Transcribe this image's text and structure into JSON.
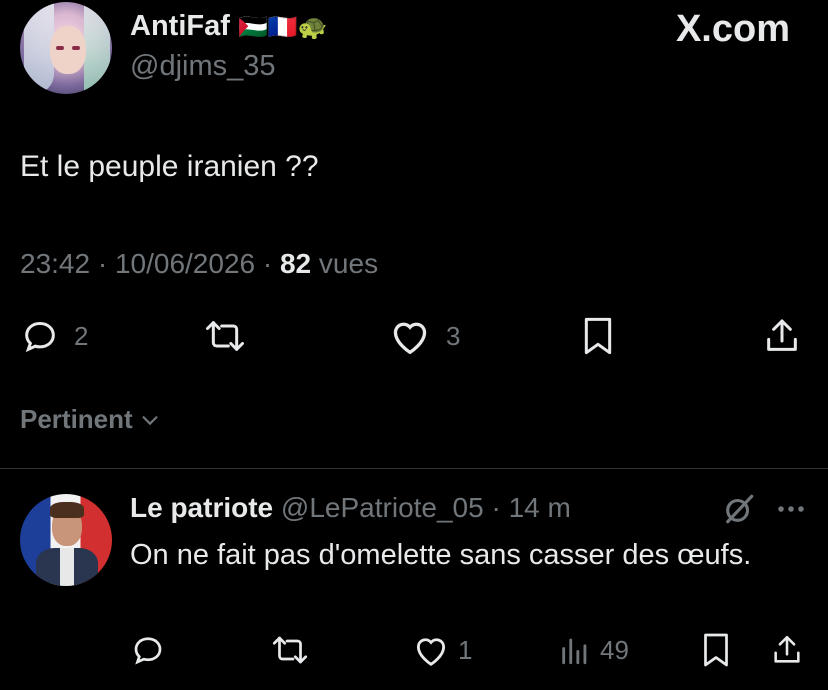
{
  "tweet": {
    "display_name": "AntiFaf",
    "flags": "🇵🇸🇫🇷🐢",
    "handle": "@djims_35",
    "brand": "X.com",
    "text": "Et le peuple iranien ??",
    "time": "23:42 · 10/06/2026 · ",
    "views_count": "82",
    "views_label": " vues",
    "actions": {
      "reply_count": "2",
      "like_count": "3"
    }
  },
  "sort": {
    "label": "Pertinent"
  },
  "reply": {
    "display_name": "Le patriote",
    "handle": "@LePatriote_05",
    "time": " · 14 m",
    "text": "On ne fait pas d'omelette sans casser des œufs.",
    "actions": {
      "like_count": "1",
      "views_count": "49"
    }
  },
  "colors": {
    "background": "#000000",
    "text": "#e7e9ea",
    "muted": "#71767b",
    "divider": "#2f3336"
  },
  "icons": [
    "reply-icon",
    "retweet-icon",
    "like-icon",
    "bookmark-icon",
    "share-icon",
    "chevron-down-icon",
    "grok-icon",
    "more-icon",
    "views-icon",
    "x-logo"
  ]
}
